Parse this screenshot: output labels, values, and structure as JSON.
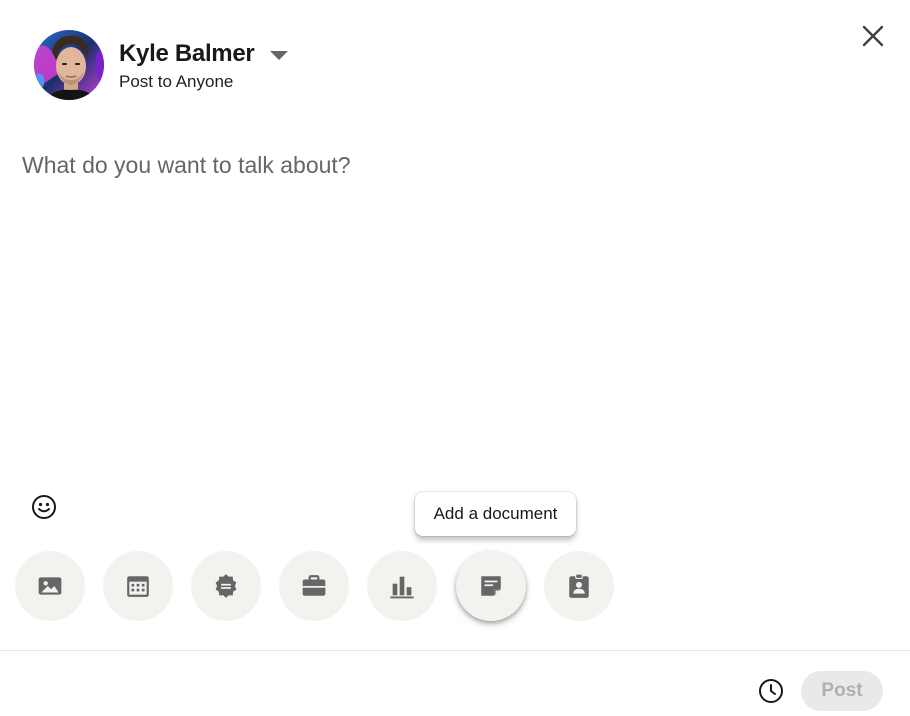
{
  "header": {
    "user_name": "Kyle Balmer",
    "audience": "Post to Anyone",
    "avatar_icon": "user-avatar-photo",
    "dropdown_icon": "caret-down-icon",
    "close_icon": "close-icon"
  },
  "composer": {
    "placeholder": "What do you want to talk about?",
    "value": ""
  },
  "emoji": {
    "icon": "emoji-icon"
  },
  "tooltip": {
    "text": "Add a document"
  },
  "tools": [
    {
      "name": "add-media",
      "icon": "image-icon"
    },
    {
      "name": "create-event",
      "icon": "calendar-icon"
    },
    {
      "name": "celebrate-occasion",
      "icon": "badge-icon"
    },
    {
      "name": "share-job",
      "icon": "briefcase-icon"
    },
    {
      "name": "create-poll",
      "icon": "bar-chart-icon"
    },
    {
      "name": "add-document",
      "icon": "document-icon",
      "active": true
    },
    {
      "name": "find-expert",
      "icon": "id-badge-icon"
    }
  ],
  "footer": {
    "schedule_icon": "clock-icon",
    "post_label": "Post",
    "post_enabled": false
  },
  "colors": {
    "tool_bg": "#f3f2ef",
    "icon": "#666666",
    "post_disabled_bg": "#e9e9e9",
    "post_disabled_text": "#b0b0b0"
  }
}
